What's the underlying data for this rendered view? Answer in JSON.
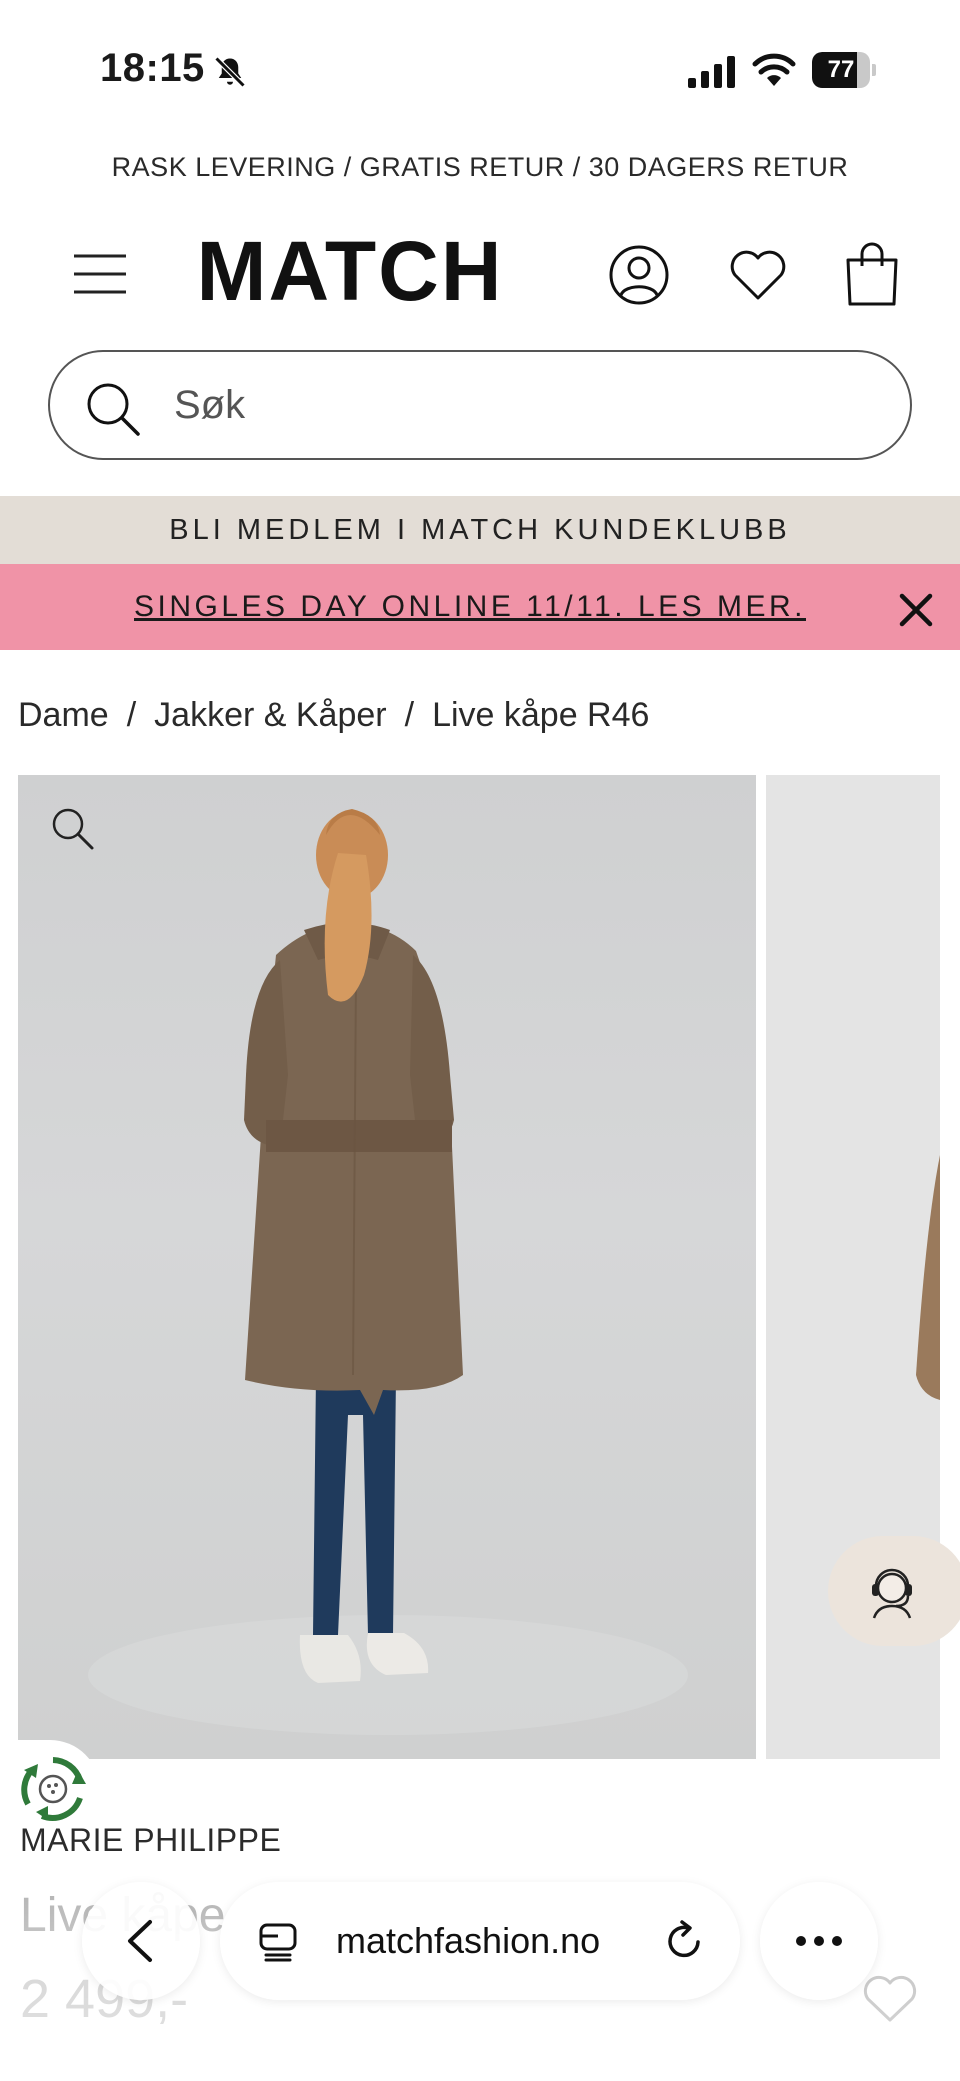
{
  "status_bar": {
    "time": "18:15",
    "battery": "77",
    "battery_level": 0.77
  },
  "promo": {
    "text": "RASK LEVERING / GRATIS RETUR / 30 DAGERS RETUR"
  },
  "header": {
    "logo": "MATCH"
  },
  "search": {
    "placeholder": "Søk"
  },
  "banners": {
    "member": "BLI MEDLEM I MATCH KUNDEKLUBB",
    "sale": "SINGLES DAY ONLINE 11/11. LES MER."
  },
  "breadcrumb": {
    "items": [
      "Dame",
      "Jakker & Kåper",
      "Live kåpe R46"
    ],
    "separator": "/"
  },
  "product": {
    "brand": "MARIE PHILIPPE",
    "name": "Live kåpe",
    "price": "2 499,-"
  },
  "browser": {
    "url": "matchfashion.no"
  },
  "colors": {
    "member_banner_bg": "#e3ddd6",
    "sale_banner_bg": "#f093a7",
    "coat": "#7b6652",
    "jeans": "#1f3a5c"
  },
  "icons": [
    "bell-slash-icon",
    "signal-icon",
    "wifi-icon",
    "menu-icon",
    "account-icon",
    "heart-icon",
    "bag-icon",
    "search-icon",
    "close-icon",
    "zoom-icon",
    "support-agent-icon",
    "eco-recycle-icon",
    "back-icon",
    "tabs-icon",
    "reload-icon",
    "more-icon"
  ]
}
